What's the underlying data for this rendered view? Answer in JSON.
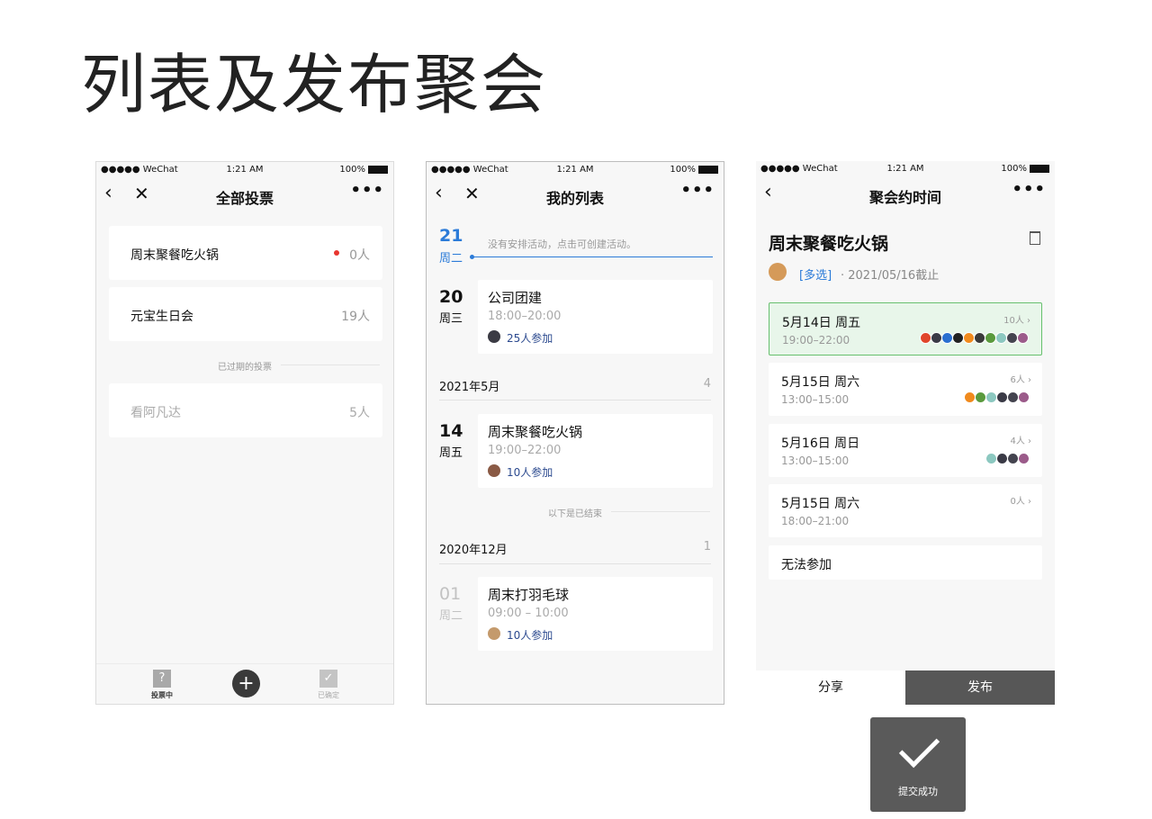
{
  "page_title": "列表及发布聚会",
  "status_bar": {
    "signal": "●●●●● WeChat",
    "time": "1:21 AM",
    "battery": "100%"
  },
  "nav_icons": {
    "back": "‹",
    "close": "✕",
    "more": "•••"
  },
  "phone1": {
    "title": "全部投票",
    "items": [
      {
        "name": "周末聚餐吃火锅",
        "count": "0人",
        "unread": true
      },
      {
        "name": "元宝生日会",
        "count": "19人",
        "unread": false
      }
    ],
    "expired_label": "已过期的投票",
    "expired_items": [
      {
        "name": "看阿凡达",
        "count": "5人"
      }
    ],
    "tabs": {
      "voting": "投票中",
      "voting_icon": "?",
      "add_icon": "+",
      "confirmed": "已确定",
      "confirmed_icon": "✓"
    }
  },
  "phone2": {
    "title": "我的列表",
    "today": {
      "day": "21",
      "weekday": "周二",
      "empty_hint": "没有安排活动，点击可创建活动。"
    },
    "events_upcoming": [
      {
        "day": "20",
        "weekday": "周三",
        "name": "公司团建",
        "time": "18:00–20:00",
        "join": "25人参加"
      }
    ],
    "month1": {
      "label": "2021年5月",
      "count": "4"
    },
    "events_may": [
      {
        "day": "14",
        "weekday": "周五",
        "name": "周末聚餐吃火锅",
        "time": "19:00–22:00",
        "join": "10人参加"
      }
    ],
    "ended_label": "以下是已结束",
    "month2": {
      "label": "2020年12月",
      "count": "1"
    },
    "events_dec": [
      {
        "day": "01",
        "weekday": "周二",
        "name": "周末打羽毛球",
        "time": "09:00 – 10:00",
        "join": "10人参加"
      }
    ]
  },
  "phone3": {
    "title": "聚会约时间",
    "poll_title": "周末聚餐吃火锅",
    "tag": "[多选]",
    "deadline": "· 2021/05/16截止",
    "slots": [
      {
        "date": "5月14日 周五",
        "time": "19:00–22:00",
        "count": "10人 ›",
        "selected": true
      },
      {
        "date": "5月15日 周六",
        "time": "13:00–15:00",
        "count": "6人 ›",
        "selected": false
      },
      {
        "date": "5月16日 周日",
        "time": "13:00–15:00",
        "count": "4人 ›",
        "selected": false
      },
      {
        "date": "5月15日 周六",
        "time": "18:00–21:00",
        "count": "0人 ›",
        "selected": false
      }
    ],
    "cannot_attend": "无法参加",
    "share": "分享",
    "publish": "发布"
  },
  "toast": {
    "label": "提交成功"
  },
  "colors": {
    "accent_blue": "#2b7bd8",
    "selected_green": "#e8f6ea",
    "unread_red": "#e8352f",
    "publish_bg": "#575757"
  }
}
